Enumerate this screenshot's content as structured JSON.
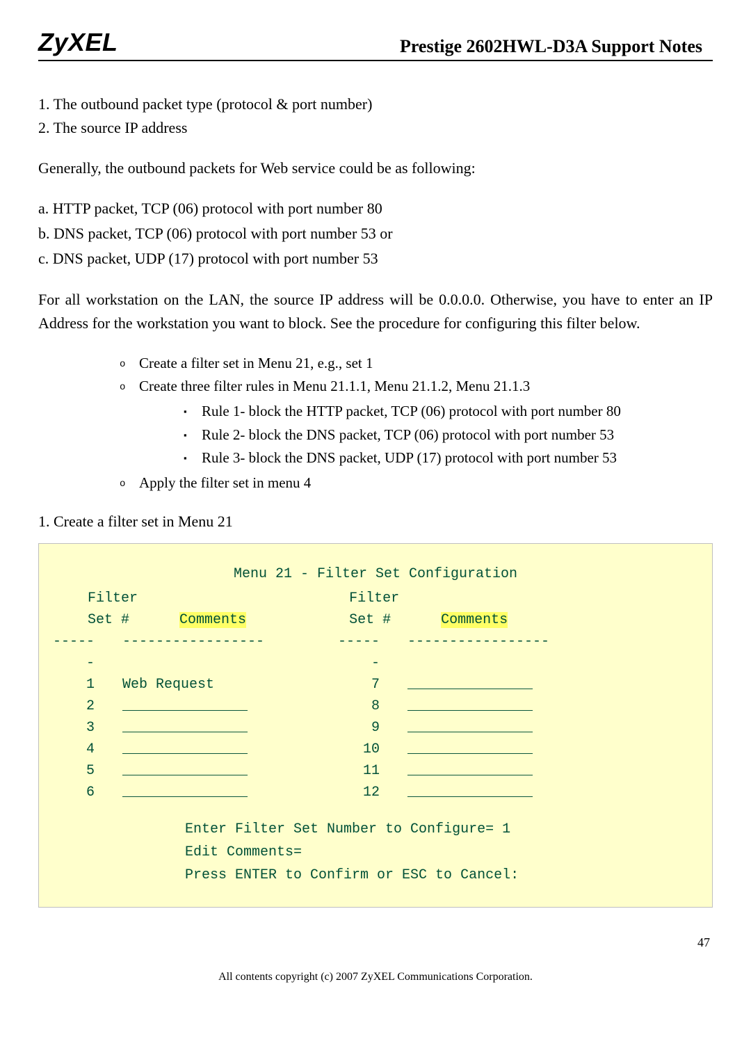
{
  "header": {
    "logo": "ZyXEL",
    "title": "Prestige 2602HWL-D3A Support Notes"
  },
  "body": {
    "line1": "1. The outbound packet type (protocol & port number)",
    "line2": "2. The source IP address",
    "para1": "Generally, the outbound packets for Web service could be as following:",
    "abc_a": "a. HTTP packet, TCP (06) protocol with port number 80",
    "abc_b": "b. DNS packet, TCP (06) protocol with port number 53 or",
    "abc_c": "c. DNS packet, UDP (17) protocol with port number 53",
    "para2": "For all workstation on the LAN, the source IP address will be 0.0.0.0. Otherwise, you have to enter an IP Address for the workstation you want to block. See the procedure for configuring this filter below.",
    "bullets": {
      "b1": "Create a filter set in Menu 21, e.g., set 1",
      "b2": "Create three filter rules in Menu 21.1.1, Menu 21.1.2, Menu 21.1.3",
      "b2_1": "Rule 1- block the HTTP packet, TCP (06) protocol with port number 80",
      "b2_2": "Rule 2- block the DNS packet, TCP (06) protocol with port number 53",
      "b2_3": "Rule 3- block the DNS packet, UDP (17) protocol with port number 53",
      "b3": "Apply the filter set in menu 4"
    },
    "section1": "1. Create a filter set in Menu 21"
  },
  "terminal": {
    "title": "Menu 21 - Filter Set Configuration",
    "h_filter": "Filter",
    "h_set": "Set #",
    "h_comments": "Comments",
    "dashes_short": "------",
    "dashes_long": "-----------------",
    "web_request": "Web Request",
    "blank": "_______________",
    "rows": [
      {
        "ln": "1",
        "rn": "7"
      },
      {
        "ln": "2",
        "rn": "8"
      },
      {
        "ln": "3",
        "rn": "9"
      },
      {
        "ln": "4",
        "rn": "10"
      },
      {
        "ln": "5",
        "rn": "11"
      },
      {
        "ln": "6",
        "rn": "12"
      }
    ],
    "prompt1": "Enter Filter Set Number to Configure= 1",
    "prompt2": "Edit Comments=",
    "prompt3": "Press ENTER to Confirm or ESC to Cancel:"
  },
  "footer": {
    "copyright": "All contents copyright (c) 2007 ZyXEL Communications Corporation.",
    "page": "47"
  }
}
